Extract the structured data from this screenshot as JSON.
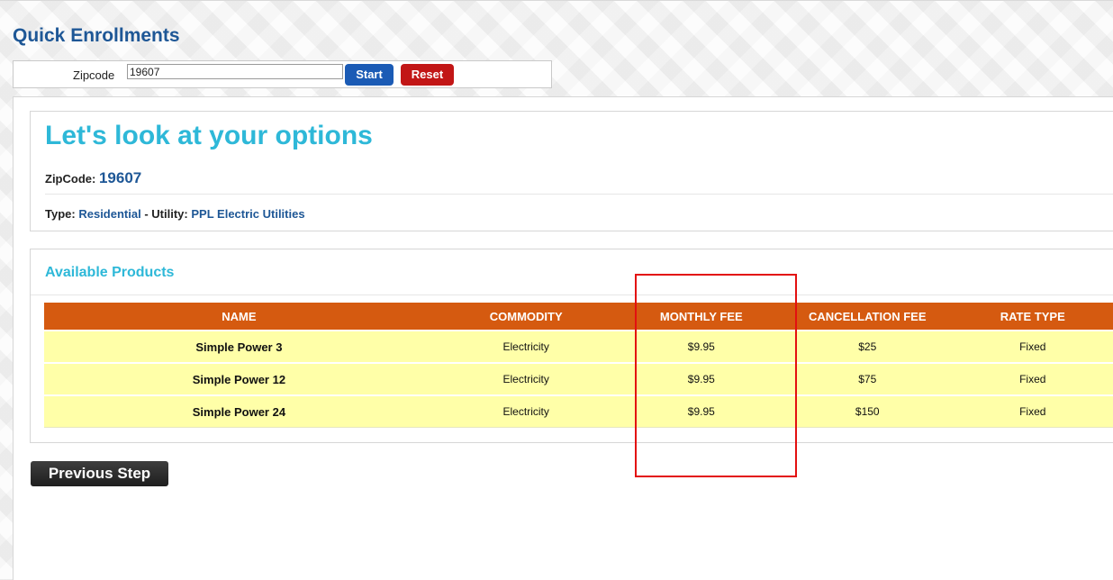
{
  "header": {
    "title": "Quick Enrollments"
  },
  "zip_form": {
    "label": "Zipcode",
    "value": "19607",
    "start_label": "Start",
    "reset_label": "Reset"
  },
  "options": {
    "title": "Let's look at your options",
    "zipcode_label": "ZipCode:",
    "zipcode_value": "19607",
    "type_label": "Type:",
    "type_value": "Residential",
    "separator": "-",
    "utility_label": "Utility:",
    "utility_value": "PPL Electric Utilities"
  },
  "products": {
    "title": "Available Products",
    "columns": [
      "NAME",
      "COMMODITY",
      "MONTHLY FEE",
      "CANCELLATION FEE",
      "RATE TYPE"
    ],
    "rows": [
      [
        "Simple Power 3",
        "Electricity",
        "$9.95",
        "$25",
        "Fixed"
      ],
      [
        "Simple Power 12",
        "Electricity",
        "$9.95",
        "$75",
        "Fixed"
      ],
      [
        "Simple Power 24",
        "Electricity",
        "$9.95",
        "$150",
        "Fixed"
      ]
    ]
  },
  "footer": {
    "previous_label": "Previous Step"
  },
  "colors": {
    "header_blue": "#1e5796",
    "accent_cyan": "#2eb8d8",
    "table_header": "#d55a10",
    "row_bg": "#ffffa8",
    "highlight_red": "#e31010"
  }
}
